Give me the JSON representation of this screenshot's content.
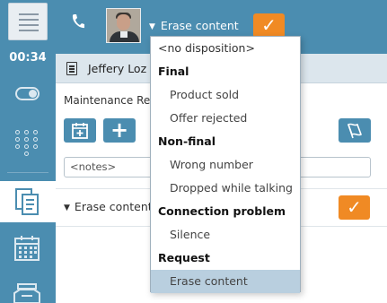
{
  "rail": {
    "timer": "00:34"
  },
  "topbar": {
    "disposition_label": "Erase content"
  },
  "panel": {
    "contact_name": "Jeffery Loz",
    "subject": "Maintenance Re",
    "notes_placeholder": "<notes>",
    "disposition_label": "Erase content"
  },
  "dropdown": {
    "no_disposition": "<no disposition>",
    "groups": [
      {
        "label": "Final",
        "options": [
          "Product sold",
          "Offer rejected"
        ]
      },
      {
        "label": "Non-final",
        "options": [
          "Wrong number",
          "Dropped while talking"
        ]
      },
      {
        "label": "Connection problem",
        "options": [
          "Silence"
        ]
      },
      {
        "label": "Request",
        "options": [
          "Erase content"
        ]
      }
    ],
    "selected": "Erase content"
  },
  "colors": {
    "brand_blue": "#4b8db0",
    "accent_orange": "#f08a24",
    "selected_row": "#b9cfdf"
  },
  "icons": [
    "menu-icon",
    "toggle-icon",
    "dialpad-icon",
    "documents-icon",
    "calendar-icon",
    "inbox-icon",
    "phone-icon",
    "document-icon",
    "calendar-add-icon",
    "plus-icon",
    "flag-icon",
    "check-icon",
    "caret-down-icon"
  ]
}
